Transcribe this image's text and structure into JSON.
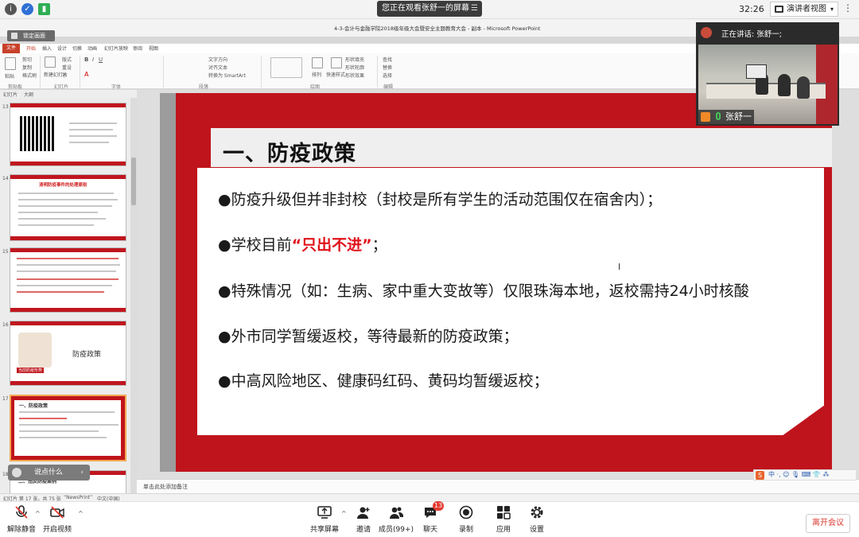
{
  "top_bar": {
    "share_notice": "您正在观看张舒一的屏幕",
    "time": "32:26",
    "presenter_view": "演讲者视图"
  },
  "ppt": {
    "window_title": "4-3-会计与金融学院2018级年级大会暨安全主题教育大会 - 副本 - Microsoft PowerPoint",
    "lock_screen": "锁定画面",
    "ribbon_tabs": [
      "文件",
      "开始",
      "插入",
      "设计",
      "切换",
      "动画",
      "幻灯片放映",
      "审阅",
      "视图"
    ],
    "ribbon_labels": {
      "paste": "粘贴",
      "cut": "剪切",
      "copy": "复制",
      "format_painter": "格式刷",
      "new_slide": "新建幻灯片",
      "layout": "版式",
      "reset": "重设",
      "section": "节",
      "text_direction": "文字方向",
      "align_text": "对齐文本",
      "smartart": "转换为 SmartArt",
      "arrange": "排列",
      "quick_styles": "快速样式",
      "shape_fill": "形状填充",
      "shape_outline": "形状轮廓",
      "shape_effects": "形状效果",
      "find": "查找",
      "replace": "替换",
      "select": "选择"
    },
    "ribbon_groups": [
      "剪贴板",
      "幻灯片",
      "字体",
      "段落",
      "绘图",
      "编辑"
    ],
    "panel_tabs": [
      "幻灯片",
      "大纲"
    ],
    "thumbnails": [
      {
        "num": "13"
      },
      {
        "num": "14",
        "title": "清明防疫事件的处理原则"
      },
      {
        "num": "15"
      },
      {
        "num": "16",
        "caption": "防疫政策",
        "tag": "当前防疫形势"
      },
      {
        "num": "17",
        "title": "一、防疫政策"
      },
      {
        "num": "18",
        "title": "二、违反防疫案例"
      }
    ],
    "speak_button": "说点什么",
    "slide": {
      "title": "一、防疫政策",
      "bullets": [
        {
          "text": "●防疫升级但并非封校（封校是所有学生的活动范围仅在宿舍内）；"
        },
        {
          "prefix": "●学校目前",
          "highlight": "“只出不进”",
          "suffix": "；"
        },
        {
          "text": "●特殊情况（如：生病、家中重大变故等）仅限珠海本地，返校需持24小时核酸"
        },
        {
          "text": "●外市同学暂缓返校，等待最新的防疫政策；"
        },
        {
          "text": "●中高风险地区、健康码红码、黄码均暂缓返校；"
        }
      ]
    },
    "notes_placeholder": "单击此处添加备注",
    "status": {
      "slide_info": "幻灯片 第 17 张，共 75 张",
      "theme": "“NewsPrint”",
      "language": "中文(中国)"
    },
    "ime_text": "中 ·, ☺ 🎙 ⌨ 👕 ⁂"
  },
  "video": {
    "speaking": "正在讲话: 张舒一;",
    "name": "张舒一"
  },
  "bottom_bar": {
    "unmute": "解除静音",
    "start_video": "开启视频",
    "share_screen": "共享屏幕",
    "invite": "邀请",
    "members": "成员(99+)",
    "chat": "聊天",
    "chat_count": "13",
    "record": "录制",
    "apps": "应用",
    "settings": "设置",
    "leave": "离开会议"
  }
}
